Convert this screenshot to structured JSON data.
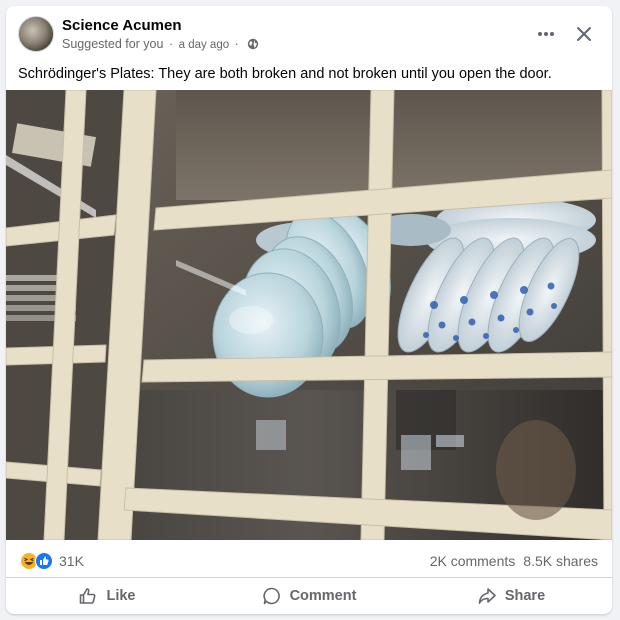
{
  "post": {
    "author": "Science Acumen",
    "suggested": "Suggested for you",
    "separator": "·",
    "time": "a day ago",
    "text": "Schrödinger's Plates: They are both broken and not broken until you open the door."
  },
  "stats": {
    "reactions_count": "31K",
    "comments": "2K comments",
    "shares": "8.5K shares"
  },
  "actions": {
    "like": "Like",
    "comment": "Comment",
    "share": "Share"
  },
  "icons": {
    "more": "more-horizontal-icon",
    "close": "close-icon",
    "privacy": "globe-icon",
    "reaction_1": "haha-reaction-icon",
    "reaction_2": "like-reaction-icon"
  },
  "colors": {
    "like_blue": "#1877f2",
    "haha_yellow": "#f7b125",
    "secondary_text": "#65676b"
  }
}
